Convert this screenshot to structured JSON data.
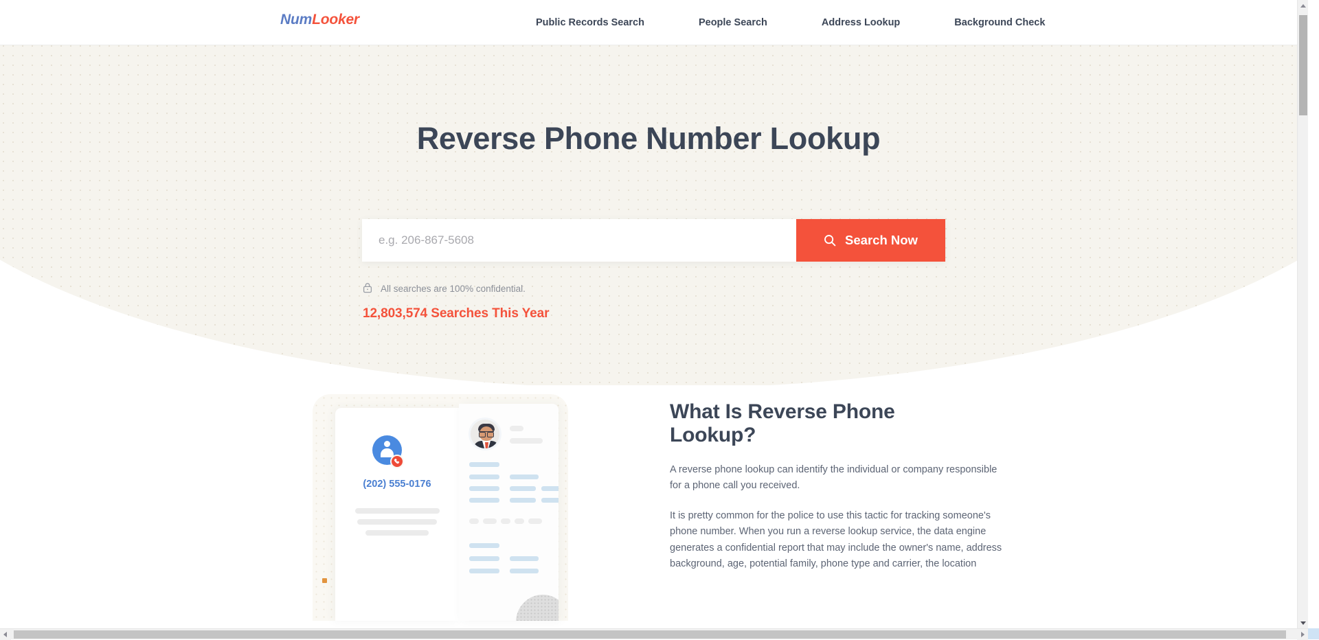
{
  "header": {
    "brand": {
      "part1": "Num",
      "part2": "Looker"
    },
    "nav": [
      {
        "label": "Public Records Search"
      },
      {
        "label": "People Search"
      },
      {
        "label": "Address Lookup"
      },
      {
        "label": "Background Check"
      }
    ]
  },
  "hero": {
    "title": "Reverse Phone Number Lookup",
    "search_placeholder": "e.g. 206-867-5608",
    "search_value": "",
    "search_button": "Search Now",
    "search_icon": "search-icon",
    "lock_icon": "lock-icon",
    "confidential_note": "All searches are 100% confidential.",
    "search_count": "12,803,574 Searches This Year"
  },
  "illustration": {
    "contact_number": "(202) 555-0176",
    "contact_icon": "contact-avatar-icon",
    "call_icon": "phone-call-icon",
    "profile_icon": "person-photo-icon"
  },
  "what_section": {
    "title": "What Is Reverse Phone Lookup?",
    "paragraphs": [
      "A reverse phone lookup can identify the individual or company responsible for a phone call you received.",
      "It is pretty common for the police to use this tactic for tracking someone's phone number. When you run a reverse lookup service, the data engine generates a confidential report that may include the owner's name, address background, age, potential family, phone type and carrier, the location"
    ]
  },
  "colors": {
    "accent_red": "#f4523b",
    "brand_blue": "#5b7cc4",
    "text_dark": "#3c4657",
    "hero_bg": "#f6f4ee",
    "link_blue": "#4a7fd1"
  },
  "scrollbars": {
    "vertical_thumb": "vertical-scrollbar-thumb",
    "horizontal_thumb": "horizontal-scrollbar-thumb"
  }
}
